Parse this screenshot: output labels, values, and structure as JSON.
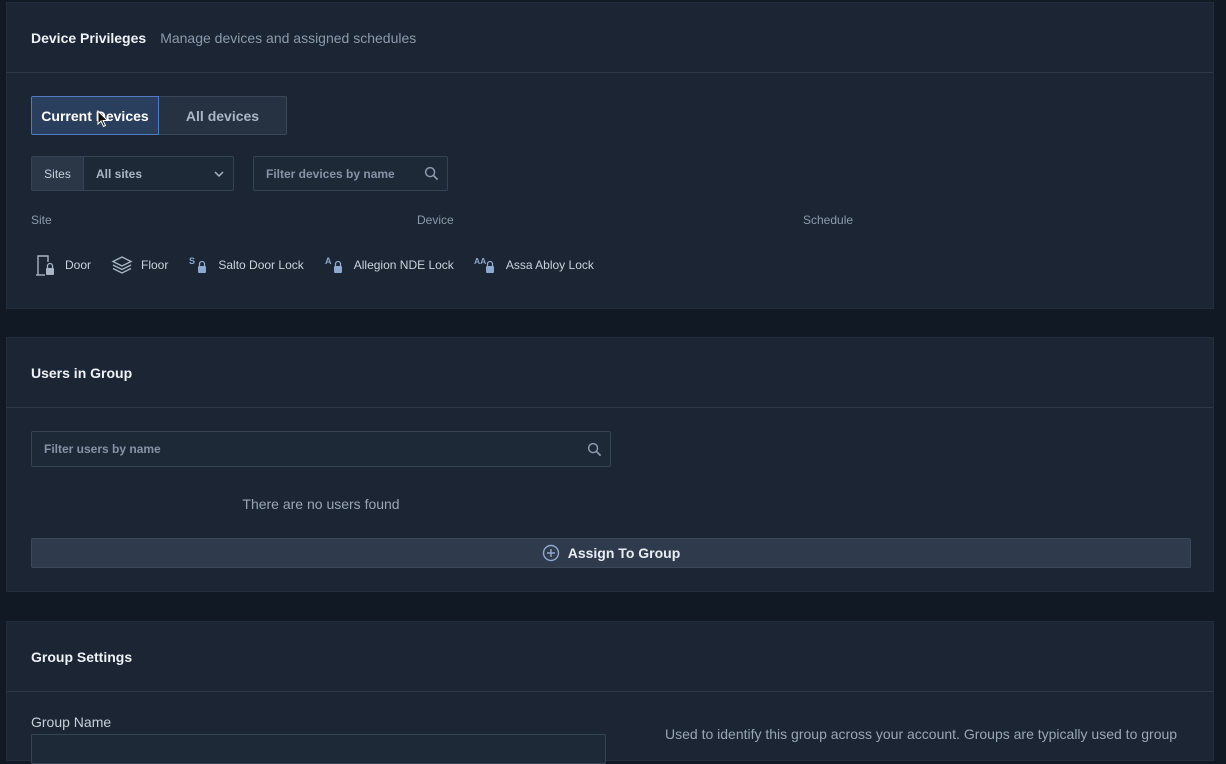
{
  "device_privileges": {
    "title": "Device Privileges",
    "subtitle": "Manage devices and assigned schedules",
    "tabs": [
      {
        "label": "Current Devices",
        "active": true
      },
      {
        "label": "All devices",
        "active": false
      }
    ],
    "sites_label": "Sites",
    "sites_selected": "All sites",
    "filter_placeholder": "Filter devices by name",
    "columns": [
      "Site",
      "Device",
      "Schedule"
    ],
    "legend": [
      {
        "label": "Door",
        "icon": "door-lock-icon"
      },
      {
        "label": "Floor",
        "icon": "layers-icon"
      },
      {
        "label": "Salto Door Lock",
        "icon": "salto-lock-icon"
      },
      {
        "label": "Allegion NDE Lock",
        "icon": "allegion-lock-icon"
      },
      {
        "label": "Assa Abloy Lock",
        "icon": "assa-abloy-lock-icon"
      }
    ]
  },
  "users_in_group": {
    "title": "Users in Group",
    "filter_placeholder": "Filter users by name",
    "empty_message": "There are no users found",
    "assign_label": "Assign To Group"
  },
  "group_settings": {
    "title": "Group Settings",
    "name_label": "Group Name",
    "help_text": "Used to identify this group across your account. Groups are typically used to group"
  },
  "colors": {
    "background": "#111a24",
    "panel": "#1b2533",
    "accent": "#4f7cc0",
    "icon": "#8fa8d0"
  }
}
